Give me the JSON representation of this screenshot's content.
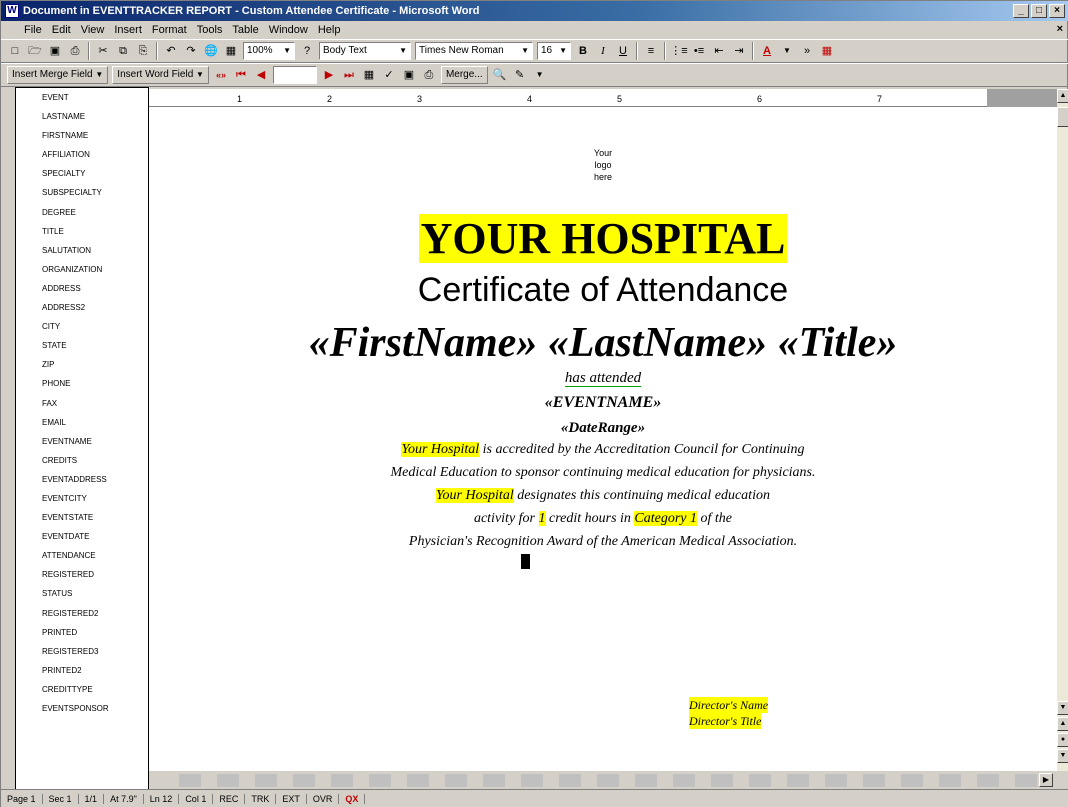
{
  "window": {
    "title": "Document in EVENTTRACKER REPORT - Custom Attendee Certificate - Microsoft Word",
    "buttons": [
      "_",
      "□",
      "×"
    ]
  },
  "menubar": {
    "items": [
      "File",
      "Edit",
      "View",
      "Insert",
      "Format",
      "Tools",
      "Table",
      "Window",
      "Help"
    ],
    "close_doc": "×"
  },
  "toolbar1": {
    "zoom": "100%",
    "style": "Body Text",
    "font": "Times New Roman",
    "size": "16",
    "bold": "B",
    "italic": "I",
    "underline": "U",
    "font_color_label": "A"
  },
  "toolbar2": {
    "insert_merge_field": "Insert Merge Field",
    "insert_word_field": "Insert Word Field",
    "record_number": "",
    "merge_label": "Merge..."
  },
  "ruler": {
    "ticks": [
      "1",
      "2",
      "3",
      "4",
      "5",
      "6",
      "7"
    ]
  },
  "field_list": {
    "items": [
      "EVENT",
      "LASTNAME",
      "FIRSTNAME",
      "AFFILIATION",
      "SPECIALTY",
      "SUBSPECIALTY",
      "DEGREE",
      "TITLE",
      "SALUTATION",
      "ORGANIZATION",
      "ADDRESS",
      "ADDRESS2",
      "CITY",
      "STATE",
      "ZIP",
      "PHONE",
      "FAX",
      "EMAIL",
      "EVENTNAME",
      "CREDITS",
      "EVENTADDRESS",
      "EVENTCITY",
      "EVENTSTATE",
      "EVENTDATE",
      "ATTENDANCE",
      "REGISTERED",
      "STATUS",
      "REGISTERED2",
      "PRINTED",
      "REGISTERED3",
      "PRINTED2",
      "CREDITTYPE",
      "EVENTSPONSOR"
    ],
    "scroll_arrow": "▼"
  },
  "document": {
    "logo_lines": [
      "Your",
      "logo",
      "here"
    ],
    "hospital": "YOUR HOSPITAL",
    "certificate": "Certificate of Attendance",
    "names": "«FirstName» «LastName» «Title»",
    "has_attended": "has attended",
    "eventname": "«EVENTNAME»",
    "daterange": "«DateRange»",
    "line1_hl": "Your Hospital",
    "line1_rest": " is accredited by the Accreditation Council for Continuing",
    "line2": "Medical Education to sponsor continuing medical education for physicians.",
    "line3_hl": "Your Hospital",
    "line3_rest": " designates this continuing medical education",
    "line4_a": "activity for ",
    "line4_hl1": "1",
    "line4_b": " credit hours in ",
    "line4_hl2": "Category 1",
    "line4_c": " of the",
    "line5": "Physician's Recognition Award of the American Medical Association.",
    "director_name": "Director's Name",
    "director_title": "Director's Title"
  },
  "statusbar": {
    "page": "Page 1",
    "sec": "Sec 1",
    "pos": "1/1",
    "at": "At 7.9\"",
    "ln": "Ln 12",
    "col": "Col 1",
    "rec": "REC",
    "trk": "TRK",
    "ext": "EXT",
    "ovr": "OVR",
    "spell": "QX"
  }
}
